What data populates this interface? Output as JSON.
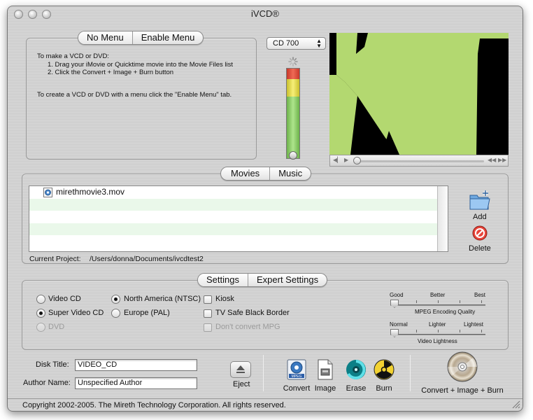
{
  "window": {
    "title": "iVCD®"
  },
  "menu_tabs": {
    "no_menu": "No Menu",
    "enable_menu": "Enable Menu"
  },
  "instructions": {
    "line1": "To make a VCD or DVD:",
    "line2": "1. Drag your iMovie or Quicktime movie into the Movie Files list",
    "line3": "2. Click the Convert + Image + Burn button",
    "line4": "To create a VCD or DVD with a menu click the \"Enable Menu\" tab."
  },
  "disc_select": {
    "value": "CD 700"
  },
  "movies_tabs": {
    "movies": "Movies",
    "music": "Music"
  },
  "movie_list": {
    "items": [
      "mirethmovie3.mov"
    ]
  },
  "project": {
    "label": "Current Project:",
    "path": "/Users/donna/Documents/ivcdtest2"
  },
  "actions": {
    "add": "Add",
    "delete": "Delete"
  },
  "settings_tabs": {
    "settings": "Settings",
    "expert": "Expert Settings"
  },
  "format": {
    "video_cd": "Video CD",
    "super_video_cd": "Super Video CD",
    "dvd": "DVD",
    "selected": "Super Video CD"
  },
  "region": {
    "ntsc": "North America (NTSC)",
    "pal": "Europe (PAL)",
    "selected": "North America (NTSC)"
  },
  "options": {
    "kiosk": "Kiosk",
    "tv_safe": "TV Safe Black Border",
    "dont_convert": "Don't convert MPG"
  },
  "quality_slider": {
    "min": "Good",
    "mid": "Better",
    "max": "Best",
    "label": "MPEG Encoding Quality",
    "value": 0
  },
  "lightness_slider": {
    "min": "Normal",
    "mid": "Lighter",
    "max": "Lightest",
    "label": "Video Lightness",
    "value": 0
  },
  "disk": {
    "title_label": "Disk Title:",
    "title_value": "VIDEO_CD",
    "author_label": "Author Name:",
    "author_value": "Unspecified Author"
  },
  "toolbar": {
    "eject": "Eject",
    "convert": "Convert",
    "image": "Image",
    "erase": "Erase",
    "burn": "Burn",
    "convert_all": "Convert + Image + Burn",
    "mpeg_badge": "MPEG"
  },
  "footer": {
    "copyright": "Copyright 2002-2005.  The Mireth Technology Corporation. All rights reserved."
  },
  "colors": {
    "list_alt_row": "#eaf8ea",
    "video_green": "#b3d870",
    "meter_red": "#e04a3a",
    "meter_yellow": "#ece24a",
    "meter_green": "#8ed06a"
  }
}
